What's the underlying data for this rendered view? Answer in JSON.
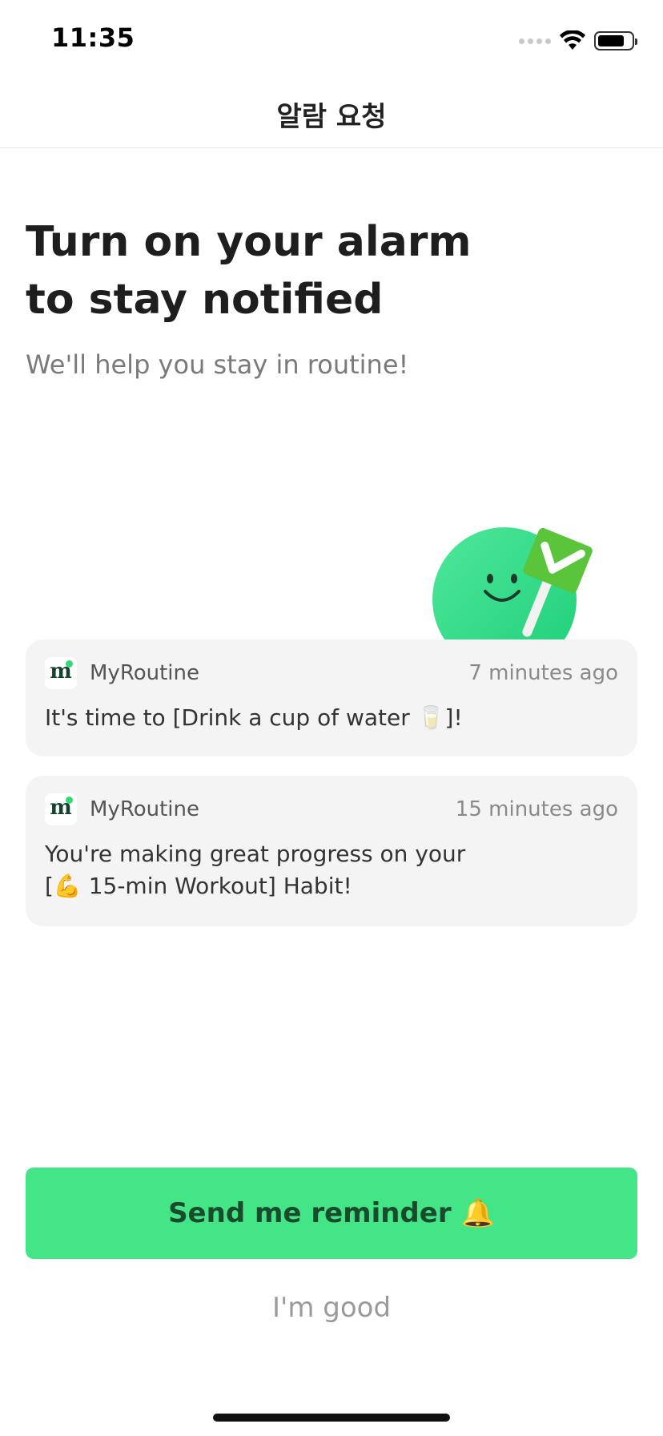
{
  "status_bar": {
    "time": "11:35",
    "battery_level": 0.8
  },
  "nav": {
    "title": "알람 요청"
  },
  "hero": {
    "headline_line1": "Turn on your alarm",
    "headline_line2": "to stay notified",
    "subtitle": "We'll help you stay in routine!"
  },
  "notifications": [
    {
      "app_name": "MyRoutine",
      "time": "7 minutes ago",
      "body_line1": "It's time to [Drink a cup of water 🥛]!",
      "body_line2": ""
    },
    {
      "app_name": "MyRoutine",
      "time": "15 minutes ago",
      "body_line1": "You're making great progress on your",
      "body_line2": "[💪 15-min Workout] Habit!"
    }
  ],
  "app_icon": {
    "letter": "m",
    "icon_name": "myroutine-logo-icon"
  },
  "actions": {
    "primary_label": "Send me reminder",
    "primary_emoji": "🔔",
    "secondary_label": "I'm good"
  },
  "colors": {
    "accent": "#44e586",
    "accent_text": "#184a2b",
    "card_bg": "#f4f4f4",
    "mascot_green": "#2ed47f"
  }
}
